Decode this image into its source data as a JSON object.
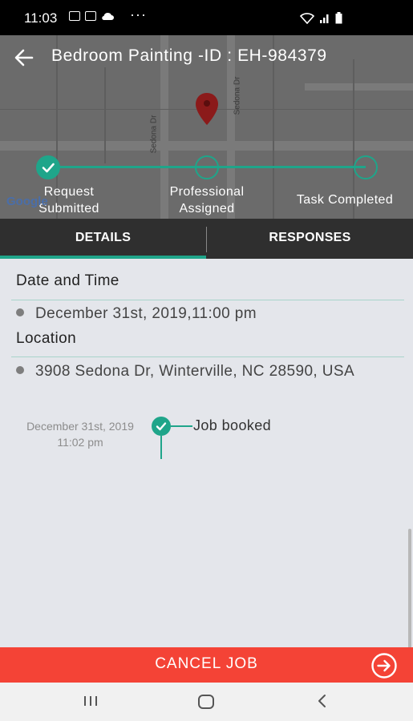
{
  "status_bar": {
    "time": "11:03",
    "dots": "···"
  },
  "header": {
    "title": "Bedroom Painting -ID :  EH-984379"
  },
  "map": {
    "streets": [
      "Sedona Dr",
      "Sedona Dr"
    ],
    "google_mark": "Google"
  },
  "progress": {
    "steps": [
      {
        "label_line1": "Request",
        "label_line2": "Submitted",
        "state": "done"
      },
      {
        "label_line1": "Professional",
        "label_line2": "Assigned",
        "state": "pending"
      },
      {
        "label_line1": "Task Completed",
        "label_line2": "",
        "state": "pending"
      }
    ],
    "accent": "#1fa58a"
  },
  "tabs": [
    {
      "label": "DETAILS",
      "active": true
    },
    {
      "label": "RESPONSES",
      "active": false
    }
  ],
  "details": {
    "date_label": "Date and Time",
    "date_value": "December 31st, 2019,11:00 pm",
    "location_label": "Location",
    "location_value": "3908 Sedona Dr, Winterville, NC 28590, USA"
  },
  "timeline": [
    {
      "date": "December 31st, 2019",
      "time": "11:02 pm",
      "event": "Job booked"
    }
  ],
  "footer": {
    "cancel_label": "CANCEL JOB",
    "color": "#f44336"
  },
  "nav_icons": [
    "recent-apps-icon",
    "home-icon",
    "back-nav-icon"
  ]
}
